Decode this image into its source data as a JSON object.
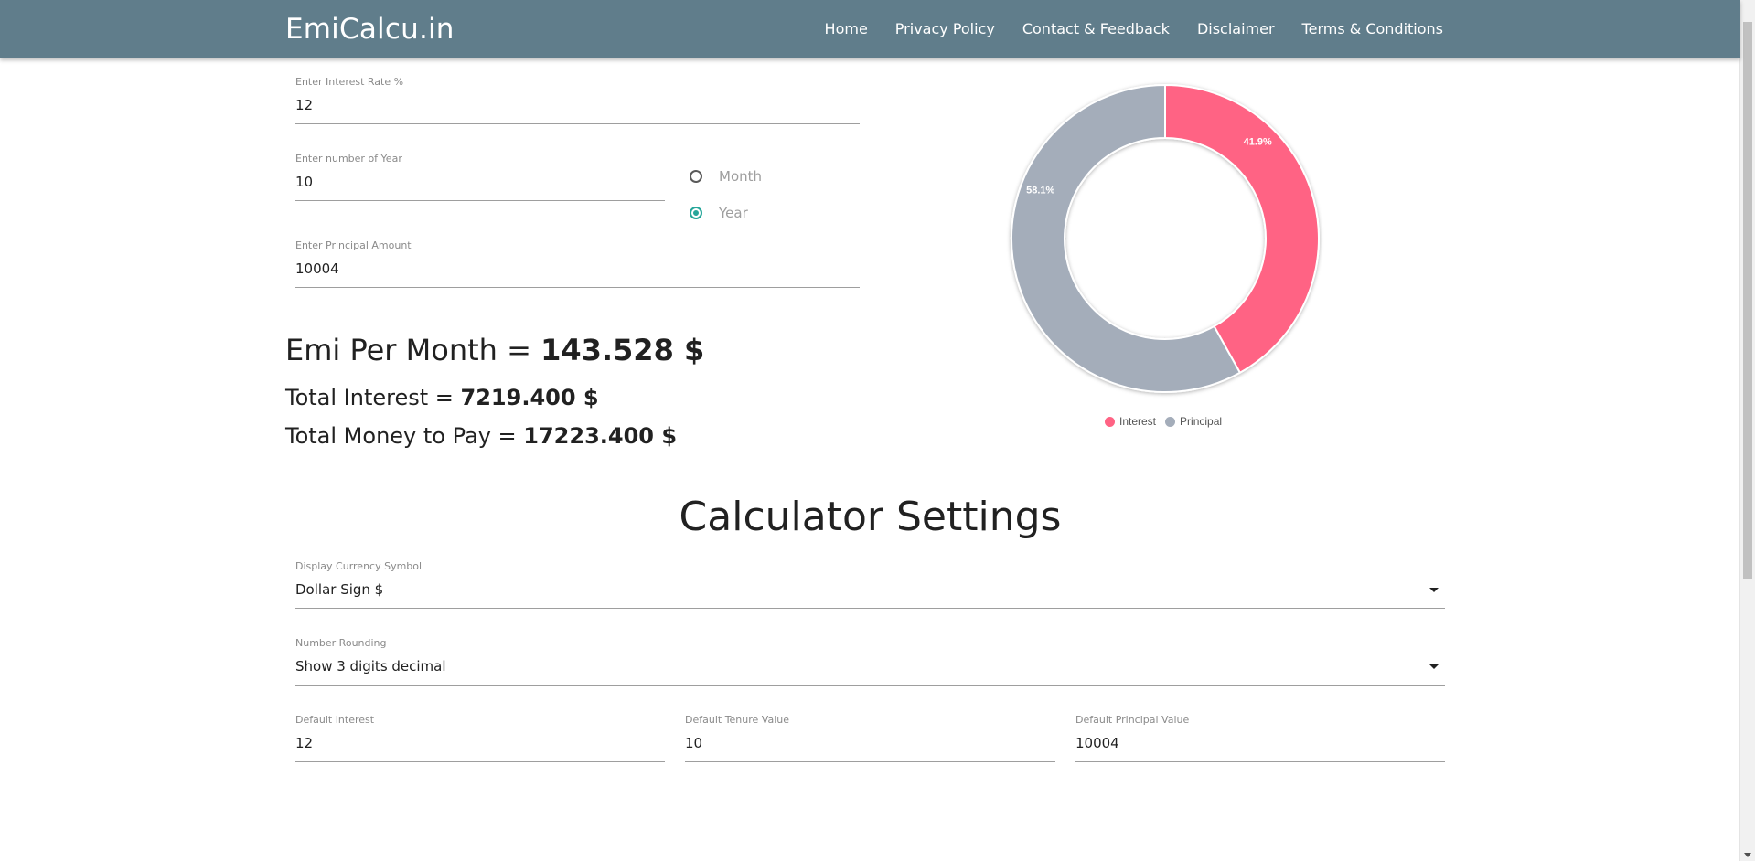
{
  "navbar": {
    "brand": "EmiCalcu.in",
    "links": [
      "Home",
      "Privacy Policy",
      "Contact & Feedback",
      "Disclaimer",
      "Terms & Conditions"
    ],
    "bg_color": "#607d8b"
  },
  "calculator": {
    "interest": {
      "label": "Enter Interest Rate %",
      "value": "12"
    },
    "tenure": {
      "label": "Enter number of Year",
      "value": "10"
    },
    "principal": {
      "label": "Enter Principal Amount",
      "value": "10004"
    },
    "tenure_unit": {
      "options": [
        "Month",
        "Year"
      ],
      "selected": "Year"
    }
  },
  "results": {
    "emi_label": "Emi Per Month = ",
    "emi_value": "143.528 $",
    "interest_label": "Total Interest = ",
    "interest_value": "7219.400 $",
    "total_label": "Total Money to Pay = ",
    "total_value": "17223.400 $"
  },
  "chart_data": {
    "type": "pie",
    "donut": true,
    "labels": [
      "Interest",
      "Principal"
    ],
    "values": [
      41.9,
      58.1
    ],
    "value_labels": [
      "41.9%",
      "58.1%"
    ],
    "colors": [
      "#ff6384",
      "#a4adba"
    ],
    "legend_position": "bottom"
  },
  "settings": {
    "title": "Calculator Settings",
    "currency": {
      "label": "Display Currency Symbol",
      "value": "Dollar Sign $"
    },
    "rounding": {
      "label": "Number Rounding",
      "value": "Show 3 digits decimal"
    },
    "default_interest": {
      "label": "Default Interest",
      "value": "12"
    },
    "default_tenure": {
      "label": "Default Tenure Value",
      "value": "10"
    },
    "default_principal": {
      "label": "Default Principal Value",
      "value": "10004"
    }
  }
}
